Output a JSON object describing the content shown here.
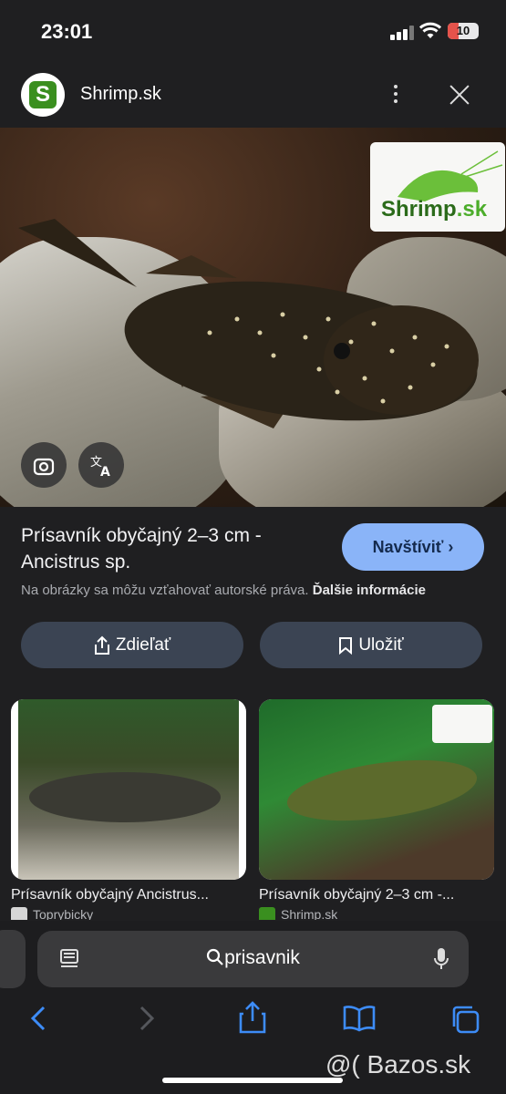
{
  "status_bar": {
    "time": "23:01",
    "battery": "10"
  },
  "header": {
    "site_name": "Shrimp.sk",
    "favicon_letter": "S"
  },
  "hero": {
    "logo_text": "Shrimp",
    "logo_tld": ".sk"
  },
  "result": {
    "title": "Prísavník obyčajný 2–3 cm - Ancistrus sp.",
    "visit_label": "Navštíviť",
    "copyright_note": "Na obrázky sa môžu vzťahovať autorské práva.",
    "more_info": "Ďalšie informácie"
  },
  "actions": {
    "share_label": "Zdieľať",
    "save_label": "Uložiť"
  },
  "related": [
    {
      "caption": "Prísavník obyčajný Ancistrus...",
      "source": "Toprybicky"
    },
    {
      "caption": "Prísavník obyčajný 2–3 cm -...",
      "source": "Shrimp.sk"
    }
  ],
  "address_bar": {
    "query": "prisavnik"
  },
  "watermark": "@( Bazos.sk",
  "colors": {
    "accent": "#8ab4f8",
    "pill_bg": "#3b4453",
    "brand_green": "#4cad2a"
  }
}
